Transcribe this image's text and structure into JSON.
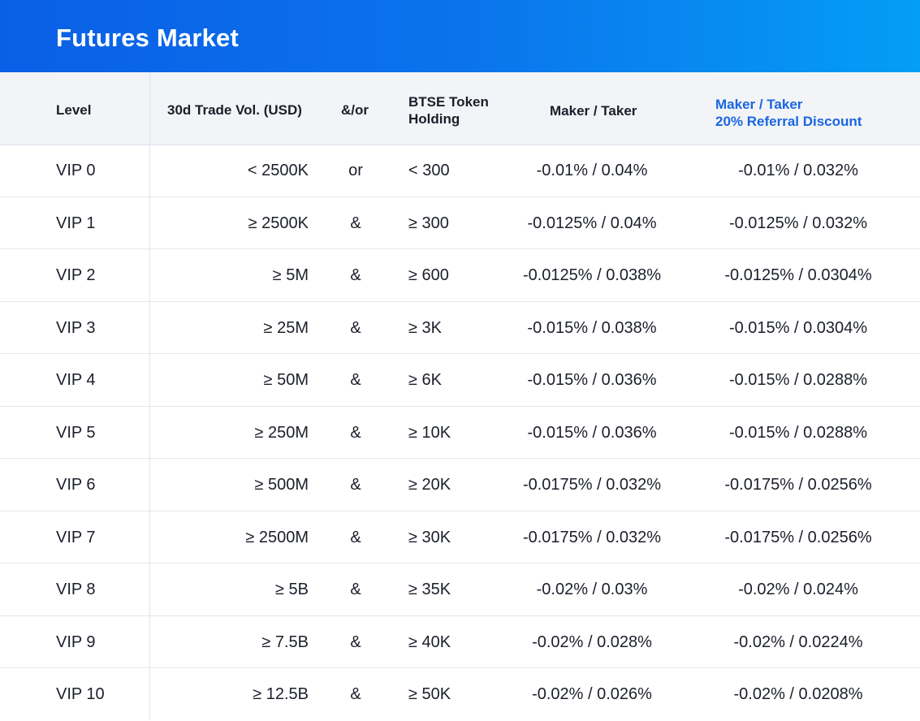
{
  "title": "Futures Market",
  "columns": {
    "level": "Level",
    "volume": "30d Trade Vol. (USD)",
    "and_or": "&/or",
    "token": "BTSE Token\nHolding",
    "maker_taker": "Maker / Taker",
    "referral": "Maker / Taker\n20% Referral Discount"
  },
  "colors": {
    "header_gradient_start": "#0a5fe6",
    "header_gradient_end": "#049ef5",
    "referral_header": "#1a66e0"
  },
  "rows": [
    {
      "level": "VIP 0",
      "volume": "< 2500K",
      "and_or": "or",
      "token": "< 300",
      "maker_taker": "-0.01% / 0.04%",
      "referral": "-0.01% / 0.032%"
    },
    {
      "level": "VIP 1",
      "volume": "≥ 2500K",
      "and_or": "&",
      "token": "≥ 300",
      "maker_taker": "-0.0125% / 0.04%",
      "referral": "-0.0125% / 0.032%"
    },
    {
      "level": "VIP 2",
      "volume": "≥ 5M",
      "and_or": "&",
      "token": "≥ 600",
      "maker_taker": "-0.0125% / 0.038%",
      "referral": "-0.0125% / 0.0304%"
    },
    {
      "level": "VIP 3",
      "volume": "≥ 25M",
      "and_or": "&",
      "token": "≥ 3K",
      "maker_taker": "-0.015% / 0.038%",
      "referral": "-0.015% / 0.0304%"
    },
    {
      "level": "VIP 4",
      "volume": "≥ 50M",
      "and_or": "&",
      "token": "≥ 6K",
      "maker_taker": "-0.015% / 0.036%",
      "referral": "-0.015% / 0.0288%"
    },
    {
      "level": "VIP 5",
      "volume": "≥ 250M",
      "and_or": "&",
      "token": "≥ 10K",
      "maker_taker": "-0.015% / 0.036%",
      "referral": "-0.015% / 0.0288%"
    },
    {
      "level": "VIP 6",
      "volume": "≥ 500M",
      "and_or": "&",
      "token": "≥ 20K",
      "maker_taker": "-0.0175% / 0.032%",
      "referral": "-0.0175% / 0.0256%"
    },
    {
      "level": "VIP 7",
      "volume": "≥ 2500M",
      "and_or": "&",
      "token": "≥ 30K",
      "maker_taker": "-0.0175% / 0.032%",
      "referral": "-0.0175% / 0.0256%"
    },
    {
      "level": "VIP 8",
      "volume": "≥ 5B",
      "and_or": "&",
      "token": "≥ 35K",
      "maker_taker": "-0.02% / 0.03%",
      "referral": "-0.02% / 0.024%"
    },
    {
      "level": "VIP 9",
      "volume": "≥ 7.5B",
      "and_or": "&",
      "token": "≥ 40K",
      "maker_taker": "-0.02% / 0.028%",
      "referral": "-0.02% / 0.0224%"
    },
    {
      "level": "VIP 10",
      "volume": "≥ 12.5B",
      "and_or": "&",
      "token": "≥ 50K",
      "maker_taker": "-0.02% / 0.026%",
      "referral": "-0.02% / 0.0208%"
    }
  ]
}
